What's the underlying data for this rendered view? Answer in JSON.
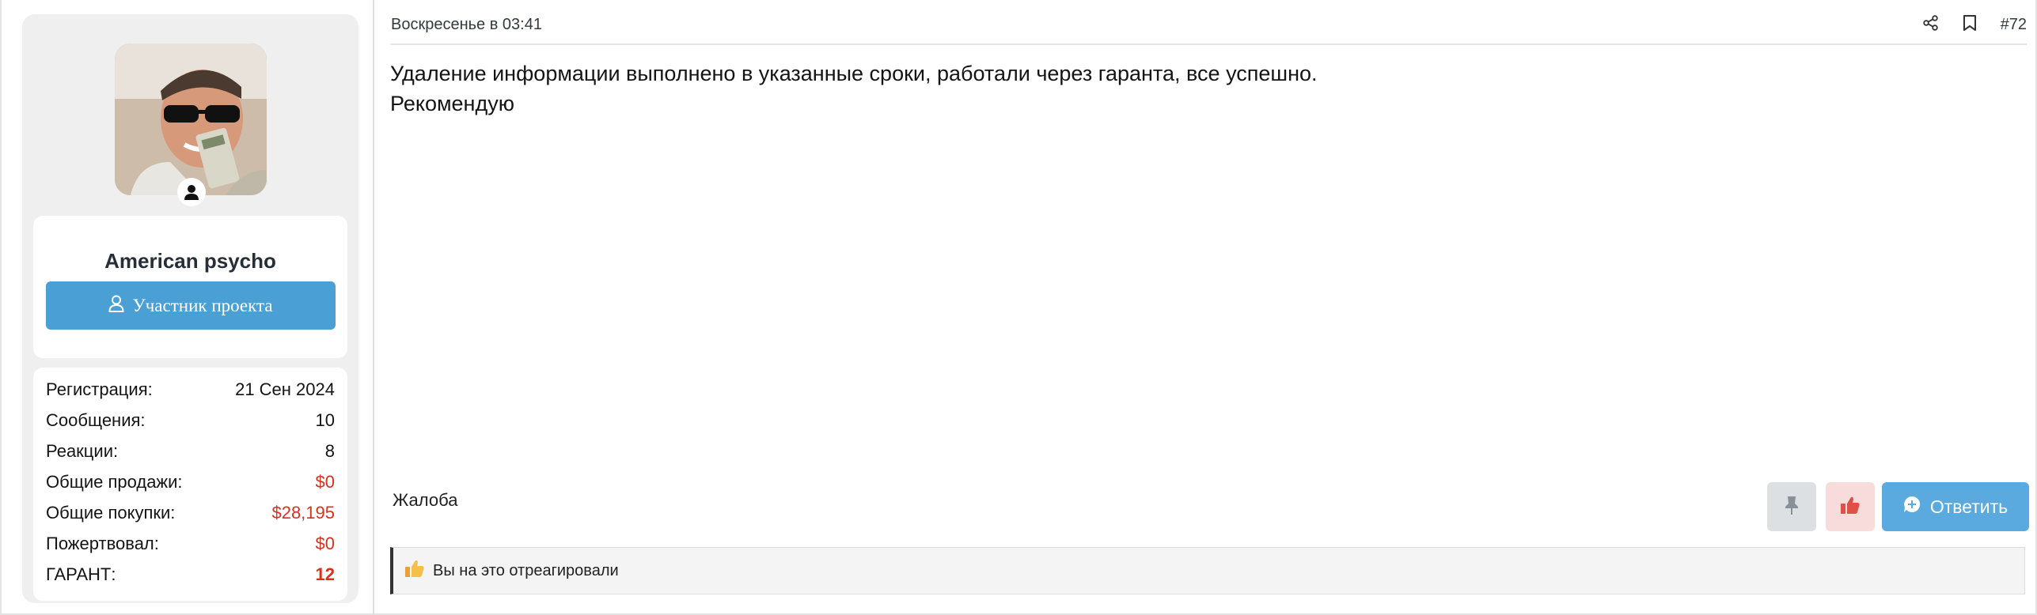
{
  "user": {
    "username": "American psycho",
    "role_label": "Участник проекта",
    "stats": [
      {
        "label": "Регистрация:",
        "value": "21 Сен 2024",
        "style": "normal"
      },
      {
        "label": "Сообщения:",
        "value": "10",
        "style": "normal"
      },
      {
        "label": "Реакции:",
        "value": "8",
        "style": "normal"
      },
      {
        "label": "Общие продажи:",
        "value": "$0",
        "style": "red"
      },
      {
        "label": "Общие покупки:",
        "value": "$28,195",
        "style": "red"
      },
      {
        "label": "Пожертвовал:",
        "value": "$0",
        "style": "red"
      },
      {
        "label": "ГАРАНТ:",
        "value": "12",
        "style": "bold"
      }
    ]
  },
  "message": {
    "date": "Воскресенье в 03:41",
    "post_number": "#72",
    "body_lines": [
      "Удаление информации выполнено в указанные сроки, работали через гаранта, все успешно.",
      "Рекомендую"
    ]
  },
  "actions": {
    "report_label": "Жалоба",
    "reply_label": "Ответить"
  },
  "reactions": {
    "text": "Вы на это отреагировали"
  },
  "colors": {
    "accent_blue": "#4aa0d5",
    "reply_blue": "#5aaae0",
    "stat_red": "#d8301f"
  },
  "icons": [
    "user-icon",
    "share-icon",
    "bookmark-icon",
    "pin-icon",
    "thumbs-up-icon",
    "reply-bubble-icon",
    "avatar-online-icon"
  ]
}
